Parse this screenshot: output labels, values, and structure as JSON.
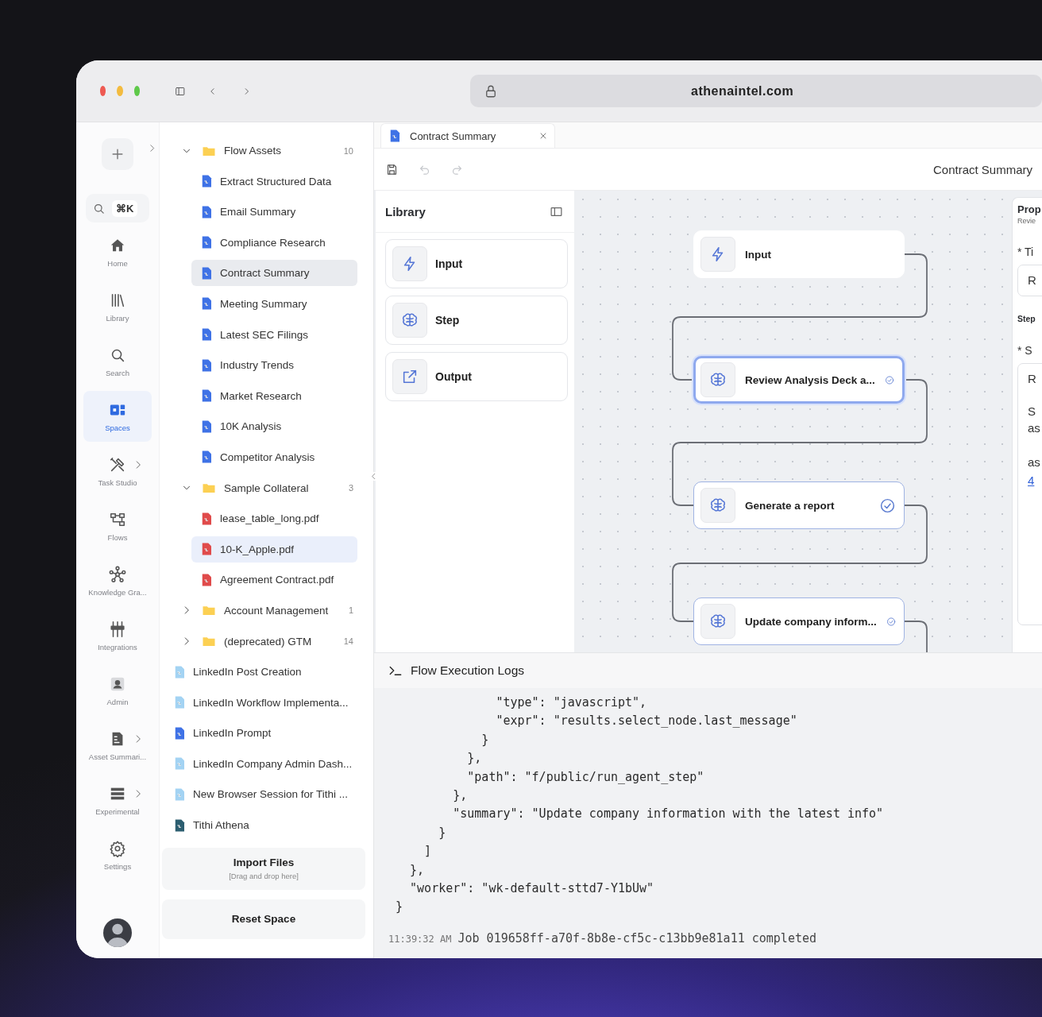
{
  "browser": {
    "url": "athenaintel.com"
  },
  "rail": {
    "shortcut": "⌘K",
    "items": [
      {
        "label": "Home",
        "selected": false,
        "submenu": false
      },
      {
        "label": "Library",
        "selected": false,
        "submenu": false
      },
      {
        "label": "Search",
        "selected": false,
        "submenu": false
      },
      {
        "label": "Spaces",
        "selected": true,
        "submenu": false
      },
      {
        "label": "Task Studio",
        "selected": false,
        "submenu": true
      },
      {
        "label": "Flows",
        "selected": false,
        "submenu": false
      },
      {
        "label": "Knowledge Gra...",
        "selected": false,
        "submenu": false
      },
      {
        "label": "Integrations",
        "selected": false,
        "submenu": false
      },
      {
        "label": "Admin",
        "selected": false,
        "submenu": false
      },
      {
        "label": "Asset Summari...",
        "selected": false,
        "submenu": true
      },
      {
        "label": "Experimental",
        "selected": false,
        "submenu": true
      },
      {
        "label": "Settings",
        "selected": false,
        "submenu": false
      }
    ]
  },
  "tree": {
    "items": [
      {
        "kind": "folder",
        "label": "Flow Assets",
        "count": "10",
        "expanded": true,
        "children": [
          {
            "kind": "flow",
            "label": "Extract Structured Data",
            "selected": false,
            "hovered": false
          },
          {
            "kind": "flow",
            "label": "Email Summary",
            "selected": false,
            "hovered": false
          },
          {
            "kind": "flow",
            "label": "Compliance Research",
            "selected": false,
            "hovered": false
          },
          {
            "kind": "flow",
            "label": "Contract Summary",
            "selected": false,
            "hovered": true
          },
          {
            "kind": "flow",
            "label": "Meeting Summary",
            "selected": false,
            "hovered": false
          },
          {
            "kind": "flow",
            "label": "Latest SEC Filings",
            "selected": false,
            "hovered": false
          },
          {
            "kind": "flow",
            "label": "Industry Trends",
            "selected": false,
            "hovered": false
          },
          {
            "kind": "flow",
            "label": "Market Research",
            "selected": false,
            "hovered": false
          },
          {
            "kind": "flow",
            "label": "10K Analysis",
            "selected": false,
            "hovered": false
          },
          {
            "kind": "flow",
            "label": "Competitor Analysis",
            "selected": false,
            "hovered": false
          }
        ]
      },
      {
        "kind": "folder",
        "label": "Sample Collateral",
        "count": "3",
        "expanded": true,
        "children": [
          {
            "kind": "pdf",
            "label": "lease_table_long.pdf",
            "selected": false,
            "hovered": false
          },
          {
            "kind": "pdf",
            "label": "10-K_Apple.pdf",
            "selected": true,
            "hovered": false
          },
          {
            "kind": "pdf",
            "label": "Agreement Contract.pdf",
            "selected": false,
            "hovered": false
          }
        ]
      },
      {
        "kind": "folder",
        "label": "Account Management",
        "count": "1",
        "expanded": false
      },
      {
        "kind": "folder",
        "label": "(deprecated) GTM",
        "count": "14",
        "expanded": false
      },
      {
        "kind": "doc-light",
        "label": "LinkedIn Post Creation",
        "selected": false,
        "hovered": false
      },
      {
        "kind": "doc-light",
        "label": "LinkedIn Workflow Implementa...",
        "selected": false,
        "hovered": false
      },
      {
        "kind": "doc",
        "label": "LinkedIn Prompt",
        "selected": false,
        "hovered": false
      },
      {
        "kind": "doc-light",
        "label": "LinkedIn Company Admin Dash...",
        "selected": false,
        "hovered": false
      },
      {
        "kind": "doc-light",
        "label": "New Browser Session for Tithi ...",
        "selected": false,
        "hovered": false
      },
      {
        "kind": "doc-dark",
        "label": "Tithi Athena",
        "selected": false,
        "hovered": false
      }
    ],
    "import": {
      "label": "Import Files",
      "hint": "[Drag and drop here]"
    },
    "reset": "Reset Space"
  },
  "tab": {
    "label": "Contract Summary"
  },
  "toolbar": {
    "buttons": [
      {
        "kind": "save",
        "disabled": false
      },
      {
        "kind": "undo",
        "disabled": true
      },
      {
        "kind": "redo",
        "disabled": true
      }
    ],
    "title": "Contract Summary"
  },
  "library": {
    "title": "Library",
    "items": [
      {
        "kind": "input",
        "label": "Input"
      },
      {
        "kind": "step",
        "label": "Step"
      },
      {
        "kind": "output",
        "label": "Output"
      }
    ]
  },
  "flow": {
    "nodes": [
      {
        "kind": "input",
        "label": "Input",
        "selected": false,
        "done": false
      },
      {
        "kind": "step",
        "label": "Review Analysis Deck a...",
        "selected": true,
        "done": true
      },
      {
        "kind": "step",
        "label": "Generate a report",
        "selected": false,
        "done": true
      },
      {
        "kind": "step",
        "label": "Update company inform...",
        "selected": false,
        "done": true
      }
    ]
  },
  "properties": {
    "title": "Prop",
    "subtitle": "Revie",
    "field_1": {
      "label": "* Ti",
      "value": "R"
    },
    "section": "Step",
    "field_2": {
      "label": "* S",
      "lines": [
        "R",
        "S",
        "as",
        "as"
      ],
      "link": "4"
    }
  },
  "logs": {
    "title": "Flow Execution Logs",
    "lines": [
      "              \"type\": \"javascript\",",
      "              \"expr\": \"results.select_node.last_message\"",
      "            }",
      "          },",
      "          \"path\": \"f/public/run_agent_step\"",
      "        },",
      "        \"summary\": \"Update company information with the latest info\"",
      "      }",
      "    ]",
      "  },",
      "  \"worker\": \"wk-default-sttd7-Y1bUw\"",
      "}"
    ],
    "status": {
      "time": "11:39:32 AM",
      "message": "Job 019658ff-a70f-8b8e-cf5c-c13bb9e81a11 completed"
    }
  }
}
